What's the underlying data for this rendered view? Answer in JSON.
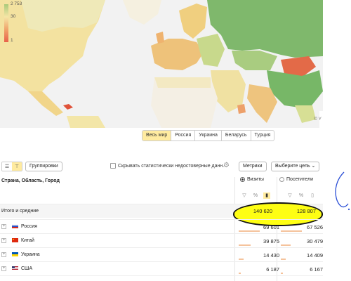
{
  "map": {
    "legend": {
      "max": "2 753",
      "mid": "30",
      "min": "1"
    },
    "copyright": "© Y"
  },
  "region_tabs": [
    "Весь мир",
    "Россия",
    "Украина",
    "Беларусь",
    "Турция"
  ],
  "toolbar": {
    "groupings_label": "Группировки",
    "hide_checkbox_label": "Скрывать статистически недостоверные данн...",
    "metrics_label": "Метрики",
    "goal_label": "Выберите цель ⌄"
  },
  "table": {
    "dimension_header": "Страна, Область, Город",
    "metric1": "Визиты",
    "metric2": "Посетители",
    "total": {
      "name": "Итого и средние",
      "visits": "140 620",
      "visitors": "128 807"
    },
    "rows": [
      {
        "name": "Россия",
        "visits": "69 601",
        "visitors": "67 526"
      },
      {
        "name": "Китай",
        "visits": "39 875",
        "visitors": "30 479"
      },
      {
        "name": "Украина",
        "visits": "14 430",
        "visitors": "14 409"
      },
      {
        "name": "США",
        "visits": "6 187",
        "visitors": "6 167"
      }
    ]
  },
  "colors": {
    "accent": "#ffeba0",
    "highlight": "#ffff00",
    "bar": "#f5c39c"
  }
}
